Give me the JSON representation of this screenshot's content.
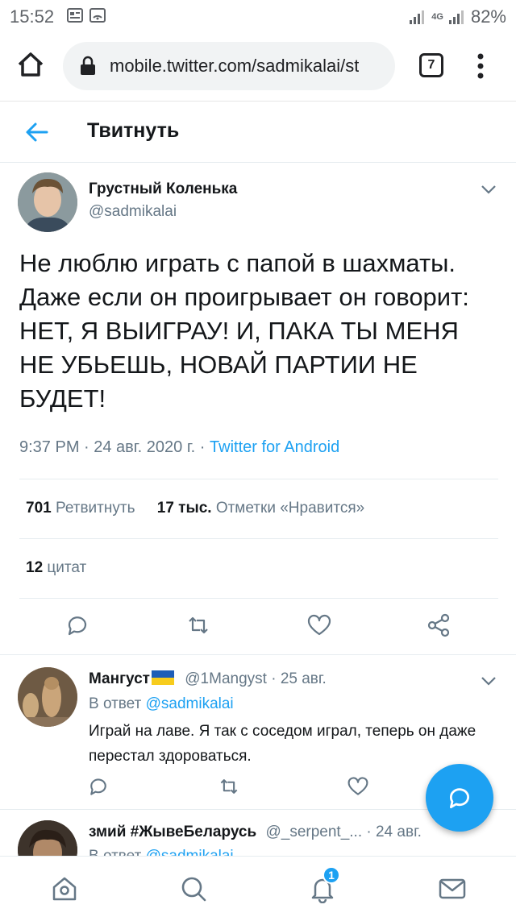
{
  "status_bar": {
    "time": "15:52",
    "network": "4G",
    "battery": "82%"
  },
  "browser": {
    "url": "mobile.twitter.com/sadmikalai/st",
    "tab_count": "7"
  },
  "header": {
    "title": "Твитнуть"
  },
  "tweet": {
    "author_name": "Грустный Коленька",
    "author_handle": "@sadmikalai",
    "text": "Не люблю играть с папой в шахматы. Даже если он проигрывает он говорит: НЕТ, Я ВЫИГРАУ! И, ПАКА ТЫ МЕНЯ НЕ УБЬЕШЬ, НОВАЙ ПАРТИИ НЕ БУДЕТ!",
    "time": "9:37 PM · 24 авг. 2020 г. · ",
    "source": "Twitter for Android",
    "retweets_count": "701",
    "retweets_label": "Ретвитнуть",
    "likes_count": "17 тыс.",
    "likes_label": "Отметки «Нравится»",
    "quotes_count": "12",
    "quotes_label": "цитат"
  },
  "replies": [
    {
      "name": "Мангуст",
      "handle": "@1Mangyst",
      "date": " · 25 авг.",
      "reply_prefix": "В ответ ",
      "reply_to": "@sadmikalai",
      "text": "Играй на лаве. Я так с соседом играл, теперь он даже перестал здороваться."
    },
    {
      "name": "змий #ЖывеБеларусь",
      "handle": "@_serpent_...",
      "date": " · 24 авг.",
      "reply_prefix": "В ответ ",
      "reply_to": "@sadmikalai"
    }
  ],
  "bottom_nav": {
    "notifications_badge": "1"
  },
  "colors": {
    "accent": "#1da1f2",
    "text": "#14171a",
    "secondary": "#657786",
    "divider": "#e6ecf0"
  }
}
